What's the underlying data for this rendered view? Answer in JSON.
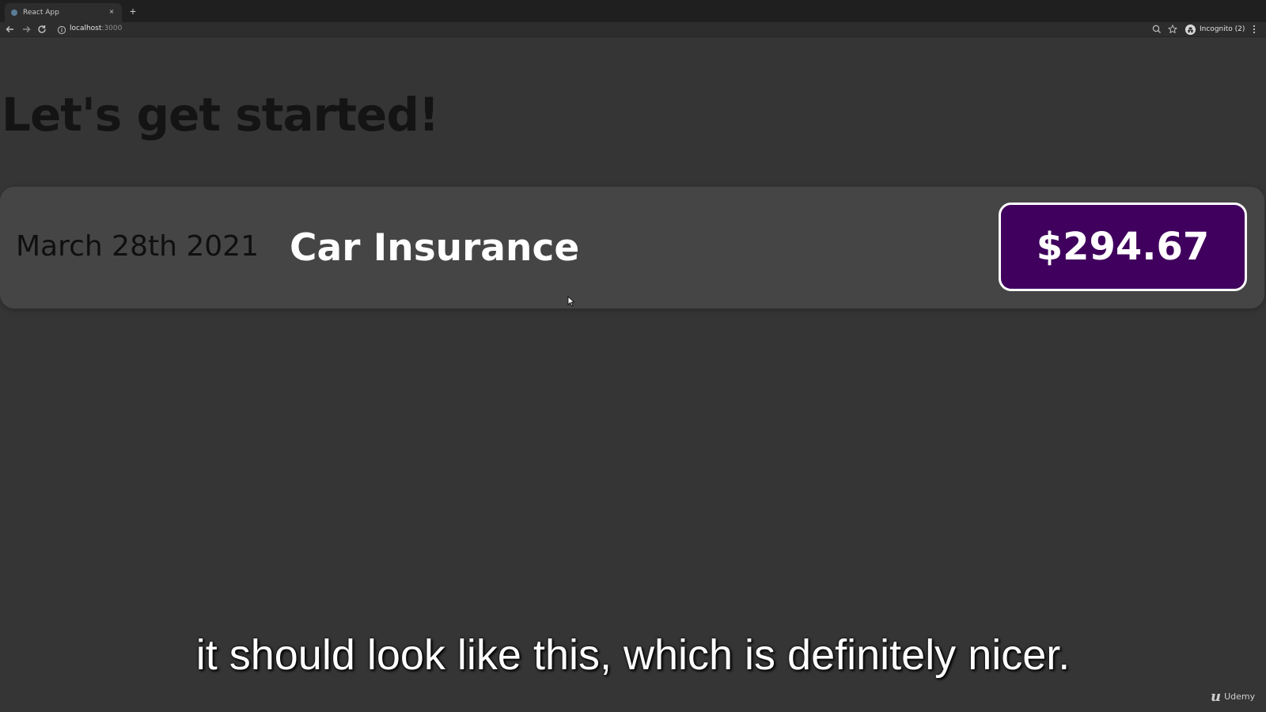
{
  "browser": {
    "tab": {
      "title": "React App",
      "close_glyph": "×"
    },
    "new_tab_glyph": "+",
    "url": {
      "host": "localhost",
      "port": ":3000"
    },
    "profile_label": "Incognito (2)"
  },
  "page": {
    "heading": "Let's get started!",
    "expense": {
      "date": "March 28th 2021",
      "title": "Car Insurance",
      "price": "$294.67"
    }
  },
  "caption": "it should look like this, which is definitely nicer.",
  "watermark": "Udemy",
  "colors": {
    "background": "#353535",
    "card": "#454545",
    "price_badge": "#40005d"
  }
}
